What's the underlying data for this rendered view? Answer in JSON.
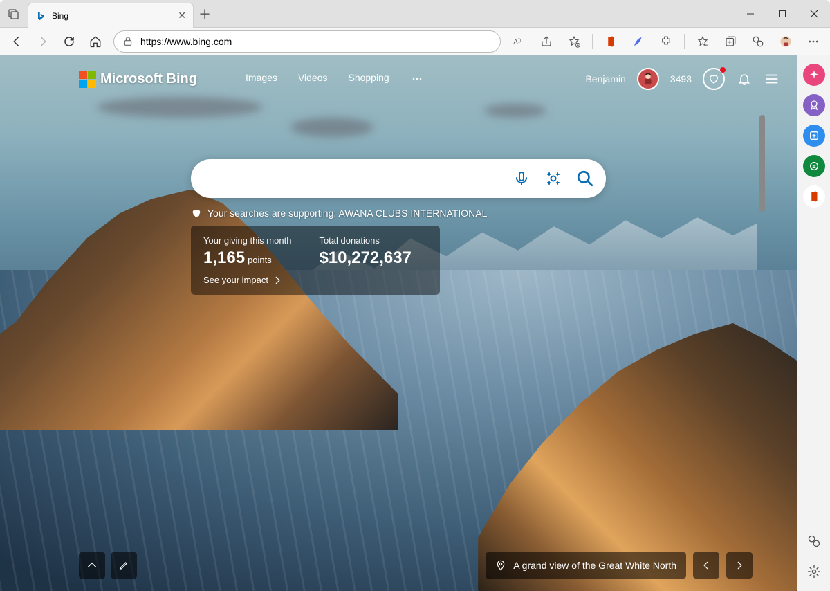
{
  "window": {
    "tab_title": "Bing",
    "url": "https://www.bing.com"
  },
  "bing": {
    "logo_text": "Microsoft Bing",
    "nav": {
      "images": "Images",
      "videos": "Videos",
      "shopping": "Shopping"
    },
    "user_name": "Benjamin",
    "points": "3493",
    "search_placeholder": "",
    "support_text": "Your searches are supporting: AWANA CLUBS INTERNATIONAL",
    "giving": {
      "month_label": "Your giving this month",
      "month_value": "1,165",
      "month_unit": "points",
      "total_label": "Total donations",
      "total_value": "$10,272,637",
      "impact": "See your impact"
    },
    "caption": "A grand view of the Great White North"
  },
  "sidebar_colors": {
    "discover": "#e8467c",
    "rewards": "#8661c5",
    "tools": "#2e8ded",
    "games": "#10893e",
    "office": "#d83b01"
  }
}
